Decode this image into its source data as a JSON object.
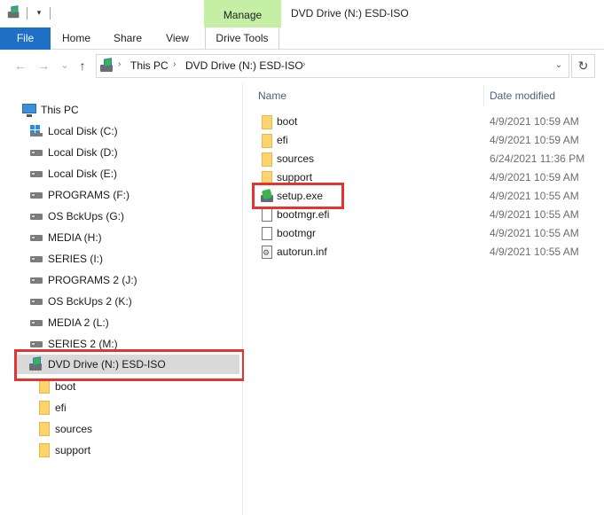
{
  "window": {
    "title": "DVD Drive (N:) ESD-ISO",
    "context_tab": "Manage",
    "qa_dropdown_icon": "chevron-down-icon"
  },
  "ribbon": {
    "tabs": [
      {
        "label": "File"
      },
      {
        "label": "Home"
      },
      {
        "label": "Share"
      },
      {
        "label": "View"
      },
      {
        "label": "Drive Tools"
      }
    ],
    "file_color": "#1e6fc6",
    "context_color": "#c6efa6"
  },
  "address": {
    "back_icon": "←",
    "forward_icon": "→",
    "recent_icon": "⌄",
    "up_icon": "↑",
    "crumbs": [
      "This PC",
      "DVD Drive (N:) ESD-ISO"
    ],
    "dropdown_icon": "⌄",
    "refresh_icon": "↻"
  },
  "navpane": {
    "root": "This PC",
    "drives": [
      {
        "label": "Local Disk (C:)",
        "icon": "windows-drive-icon"
      },
      {
        "label": "Local Disk (D:)",
        "icon": "hdd-icon"
      },
      {
        "label": "Local Disk (E:)",
        "icon": "hdd-icon"
      },
      {
        "label": "PROGRAMS (F:)",
        "icon": "hdd-icon"
      },
      {
        "label": "OS BckUps (G:)",
        "icon": "hdd-icon"
      },
      {
        "label": "MEDIA (H:)",
        "icon": "hdd-icon"
      },
      {
        "label": "SERIES (I:)",
        "icon": "hdd-icon"
      },
      {
        "label": "PROGRAMS 2 (J:)",
        "icon": "hdd-icon"
      },
      {
        "label": "OS BckUps 2 (K:)",
        "icon": "hdd-icon"
      },
      {
        "label": "MEDIA 2 (L:)",
        "icon": "hdd-icon"
      },
      {
        "label": "SERIES 2 (M:)",
        "icon": "hdd-icon"
      }
    ],
    "selected": {
      "label": "DVD Drive (N:) ESD-ISO",
      "icon": "dvd-drive-icon"
    },
    "subfolders": [
      "boot",
      "efi",
      "sources",
      "support"
    ],
    "highlight_color": "#e33333"
  },
  "content": {
    "columns": {
      "name": "Name",
      "date": "Date modified"
    },
    "files": [
      {
        "name": "boot",
        "date": "4/9/2021 10:59 AM",
        "icon": "folder-icon"
      },
      {
        "name": "efi",
        "date": "4/9/2021 10:59 AM",
        "icon": "folder-icon"
      },
      {
        "name": "sources",
        "date": "6/24/2021 11:36 PM",
        "icon": "folder-icon"
      },
      {
        "name": "support",
        "date": "4/9/2021 10:59 AM",
        "icon": "folder-icon"
      },
      {
        "name": "setup.exe",
        "date": "4/9/2021 10:55 AM",
        "icon": "setup-icon"
      },
      {
        "name": "bootmgr.efi",
        "date": "4/9/2021 10:55 AM",
        "icon": "file-icon"
      },
      {
        "name": "bootmgr",
        "date": "4/9/2021 10:55 AM",
        "icon": "file-icon"
      },
      {
        "name": "autorun.inf",
        "date": "4/9/2021 10:55 AM",
        "icon": "settings-file-icon"
      }
    ]
  }
}
